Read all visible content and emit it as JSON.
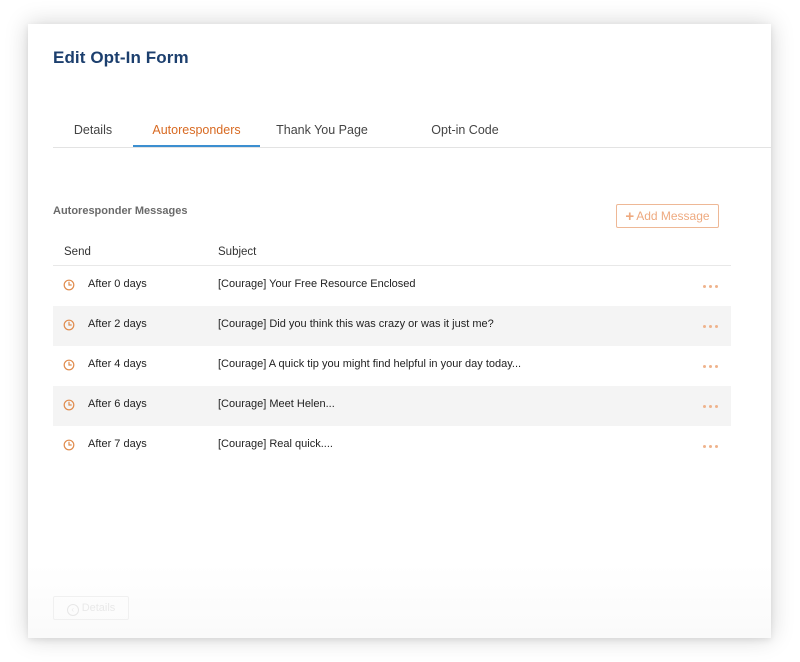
{
  "page": {
    "title": "Edit Opt-In Form"
  },
  "tabs": [
    {
      "label": "Details",
      "active": false
    },
    {
      "label": "Autoresponders",
      "active": true
    },
    {
      "label": "Thank You Page",
      "active": false
    },
    {
      "label": "Opt-in Code",
      "active": false
    }
  ],
  "section": {
    "heading": "Autoresponder Messages",
    "add_button_label": "Add Message",
    "add_button_icon": "plus-icon"
  },
  "table": {
    "columns": {
      "send": "Send",
      "subject": "Subject"
    },
    "rows": [
      {
        "send": "After 0 days",
        "subject": "[Courage] Your Free Resource Enclosed"
      },
      {
        "send": "After 2 days",
        "subject": "[Courage] Did you think this was crazy or was it just me?"
      },
      {
        "send": "After 4 days",
        "subject": "[Courage] A quick tip you might find helpful in your day today..."
      },
      {
        "send": "After 6 days",
        "subject": "[Courage] Meet Helen..."
      },
      {
        "send": "After 7 days",
        "subject": "[Courage] Real quick...."
      }
    ],
    "row_icon": "clock-icon",
    "row_action_icon": "more-dots-icon"
  },
  "footer": {
    "back_button_label": "Details",
    "back_button_icon": "arrow-left-circle-icon"
  },
  "colors": {
    "title": "#1c3f6e",
    "accent_orange": "#d86a22",
    "tab_underline": "#3c8fd0",
    "row_alt_bg": "#f4f4f4"
  }
}
